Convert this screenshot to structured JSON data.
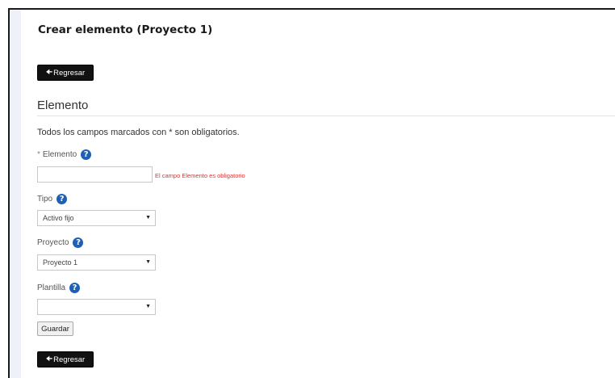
{
  "page": {
    "title": "Crear elemento (Proyecto 1)",
    "back_label": "Regresar",
    "section_title": "Elemento",
    "required_note": "Todos los campos marcados con * son obligatorios."
  },
  "fields": {
    "elemento": {
      "required_mark": "*",
      "label": "Elemento",
      "value": "",
      "error": "El campo Elemento es obligatorio"
    },
    "tipo": {
      "label": "Tipo",
      "selected": "Activo fijo"
    },
    "proyecto": {
      "label": "Proyecto",
      "selected": "Proyecto 1"
    },
    "plantilla": {
      "label": "Plantilla",
      "selected": ""
    }
  },
  "actions": {
    "save_label": "Guardar"
  },
  "icons": {
    "help": "question-circle-icon",
    "back_arrow": "arrow-left-icon",
    "select_caret": "caret-down-icon"
  },
  "colors": {
    "back_button_bg": "#111111",
    "help_icon": "#1f5fb4",
    "error": "#e03131"
  }
}
